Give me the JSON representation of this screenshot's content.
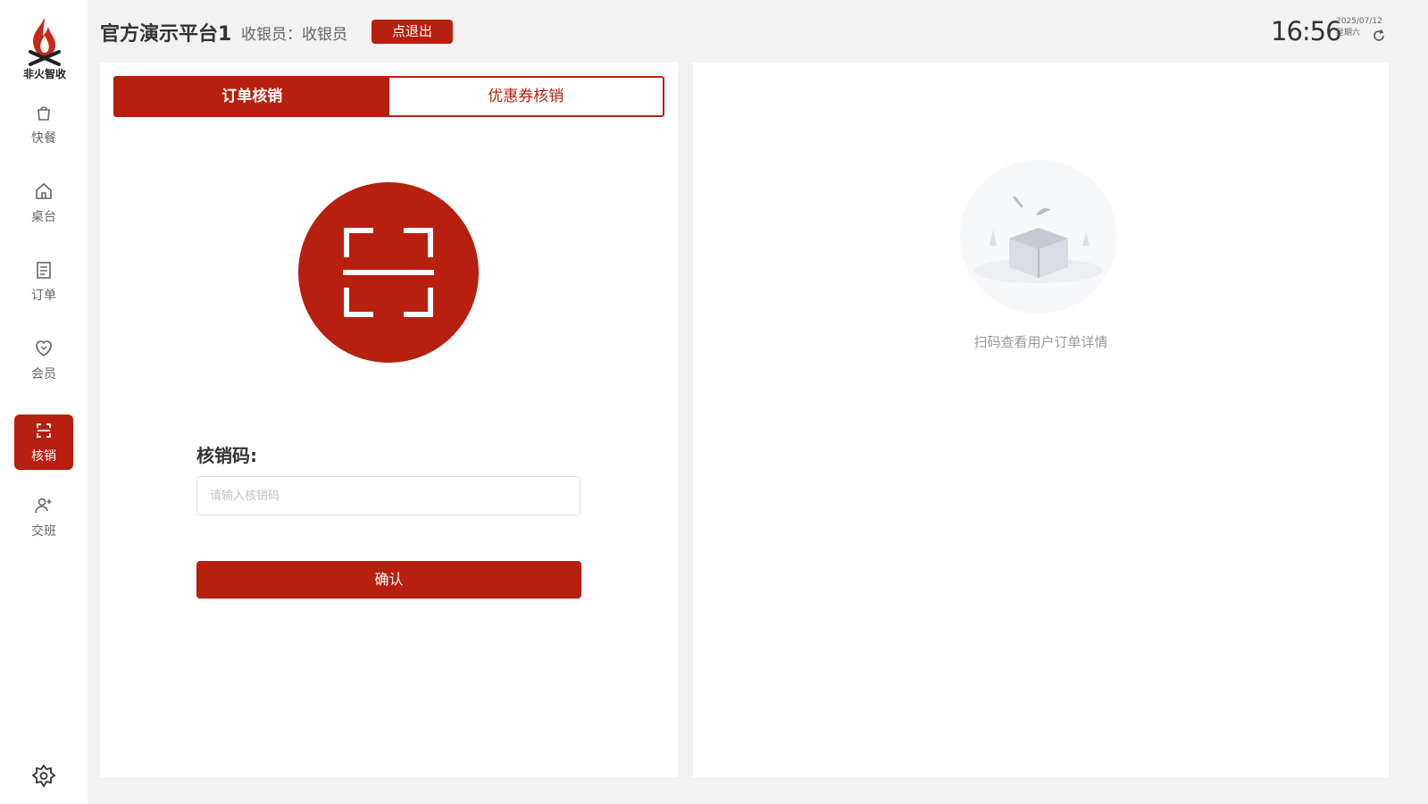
{
  "colors": {
    "accent": "#b71f0f",
    "background": "#f2f2f2",
    "panel": "#ffffff"
  },
  "sidebar": {
    "logo": {
      "icon": "flame-logo-icon",
      "text": "非火智收"
    },
    "items": [
      {
        "label": "快餐",
        "icon": "bag-icon",
        "active": false
      },
      {
        "label": "桌台",
        "icon": "home-icon",
        "active": false
      },
      {
        "label": "订单",
        "icon": "order-list-icon",
        "active": false
      },
      {
        "label": "会员",
        "icon": "heart-shield-icon",
        "active": false
      },
      {
        "label": "核销",
        "icon": "scan-icon",
        "active": true
      },
      {
        "label": "交班",
        "icon": "user-switch-icon",
        "active": false
      }
    ],
    "settings_icon": "settings-flower-icon"
  },
  "header": {
    "store_name": "官方演示平台1",
    "cashier": "收银员：收银员",
    "logout_label": "点退出",
    "time": "16:56",
    "date": "2025/07/12",
    "weekday": "星期六",
    "refresh_icon": "refresh-icon"
  },
  "left_panel": {
    "tabs": [
      {
        "label": "订单核销",
        "active": true
      },
      {
        "label": "优惠券核销",
        "active": false
      }
    ],
    "scan_icon": "scan-frame-icon",
    "code_label": "核销码:",
    "code_input": {
      "value": "",
      "placeholder": "请输入核销码"
    },
    "confirm_label": "确认"
  },
  "right_panel": {
    "empty_icon": "empty-box-icon",
    "empty_text": "扫码查看用户订单详情"
  }
}
